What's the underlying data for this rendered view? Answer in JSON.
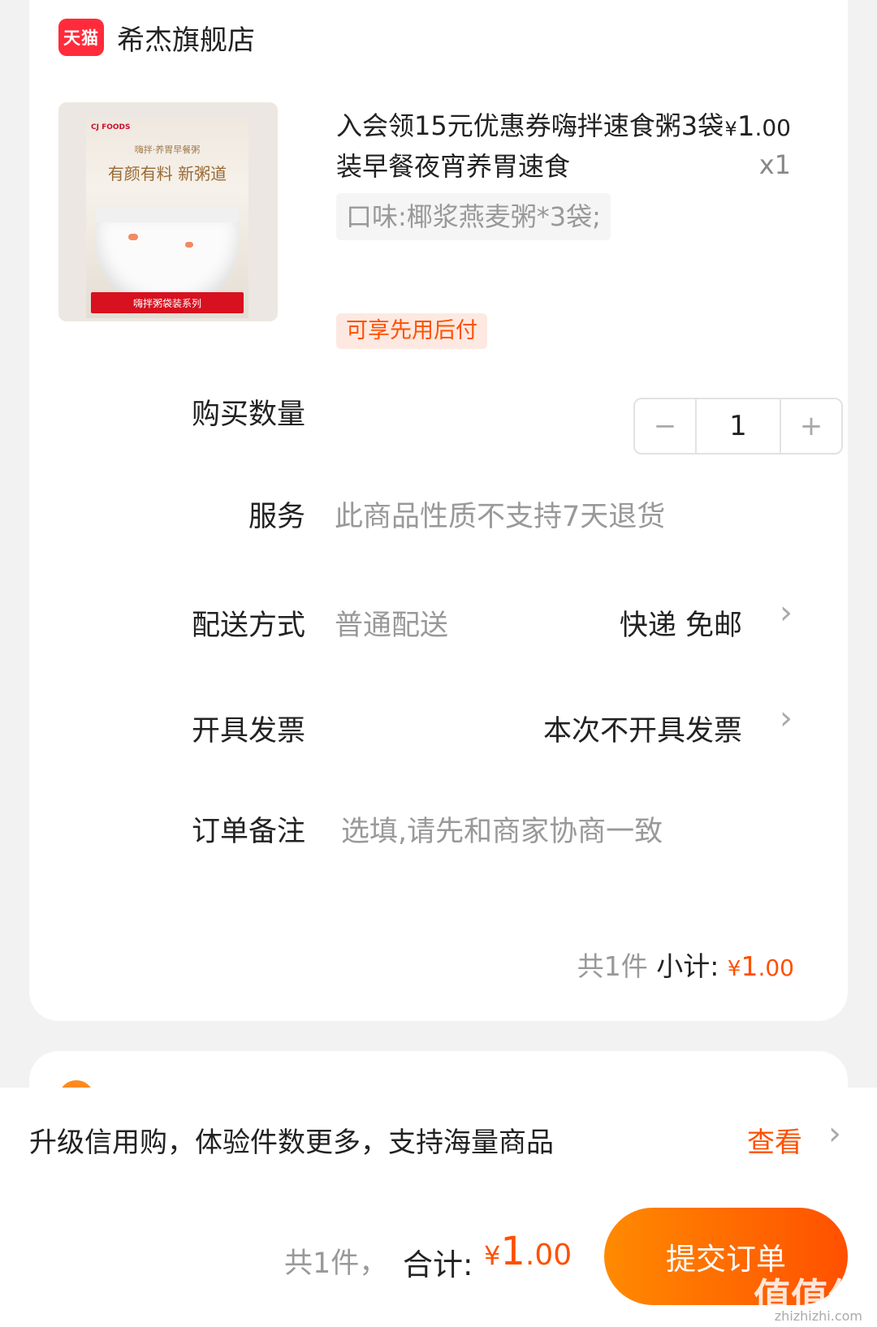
{
  "shop": {
    "logo_text": "天猫",
    "name": "希杰旗舰店"
  },
  "product": {
    "image_brand": "CJ FOODS",
    "image_subtitle": "嗨拌·养胃早餐粥",
    "image_title": "有颜有料 新粥道",
    "image_banner": "嗨拌粥袋装系列",
    "title": "入会领15元优惠券嗨拌速食粥3袋装早餐夜宵养胃速食",
    "price_currency": "¥",
    "price_int": "1",
    "price_dec": ".00",
    "quantity_label": "x1",
    "spec": "口味:椰浆燕麦粥*3袋;",
    "badge": "可享先用后付"
  },
  "rows": {
    "quantity": {
      "label": "购买数量",
      "minus": "−",
      "value": "1",
      "plus": "+"
    },
    "service": {
      "label": "服务",
      "value": "此商品性质不支持7天退货"
    },
    "delivery": {
      "label": "配送方式",
      "value": "普通配送",
      "right": "快递 免邮"
    },
    "invoice": {
      "label": "开具发票",
      "right": "本次不开具发票"
    },
    "remark": {
      "label": "订单备注",
      "placeholder": "选填,请先和商家协商一致"
    }
  },
  "subtotal": {
    "count": "共1件",
    "label": "小计:",
    "currency": "¥",
    "int": "1",
    "dec": ".00"
  },
  "promo": {
    "text": "升级信用购，体验件数更多，支持海量商品",
    "link": "查看"
  },
  "footer": {
    "count": "共1件，",
    "total_label": "合计:",
    "currency": "¥",
    "int": "1",
    "dec": ".00",
    "submit": "提交订单"
  },
  "watermark": {
    "text": "值值值",
    "url": "zhizhizhi.com"
  },
  "colors": {
    "accent": "#ff5000",
    "tmall": "#ff2b3b"
  },
  "icons": {
    "chevron": "chevron-right-icon"
  }
}
